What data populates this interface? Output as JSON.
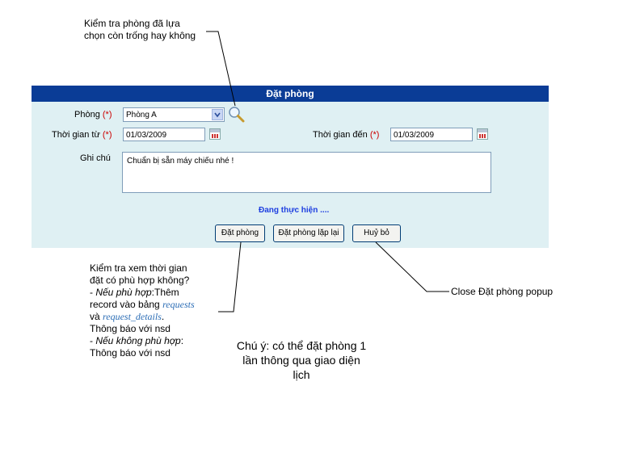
{
  "annotations": {
    "search_note_line1": "Kiểm tra phòng đã lựa",
    "search_note_line2": "chọn còn trống hay không",
    "book_note": {
      "l1": "Kiểm tra xem thời gian",
      "l2": "đặt có phù hợp không?",
      "l3_prefix": "- ",
      "l3_italic": "Nếu phù hợp",
      "l3_rest": ":Thêm",
      "l4_text": "record vào bảng ",
      "l4_table": "requests",
      "l5_text": "và ",
      "l5_table": "request_details",
      "l5_end": ".",
      "l6": "Thông báo với nsd",
      "l7_prefix": "- ",
      "l7_italic": "Nếu không phù hợp",
      "l7_rest": ":",
      "l8": "Thông báo với nsd"
    },
    "cancel_note": "Close Đặt phòng popup",
    "footnote_line1": "Chú ý: có thể đặt phòng 1",
    "footnote_line2": "lần thông qua giao diện",
    "footnote_line3": "lịch"
  },
  "dialog": {
    "title": "Đặt phòng",
    "room_label": "Phòng",
    "required_mark": "(*)",
    "room_value": "Phòng A",
    "from_label": "Thời gian từ",
    "from_value": "01/03/2009",
    "to_label": "Thời gian đến",
    "to_value": "01/03/2009",
    "note_label": "Ghi chú",
    "note_value": "Chuẩn bị sẵn máy chiếu nhé !",
    "status_text": "Đang thực hiện ....",
    "book_button": "Đặt phòng",
    "recurring_button": "Đặt phòng lặp lại",
    "cancel_button": "Huỷ bỏ"
  },
  "icons": {
    "search": "magnifier-icon",
    "dropdown": "chevron-down-icon",
    "calendar": "calendar-icon"
  },
  "colors": {
    "title_bar": "#0a3c96",
    "panel_bg": "#dff0f3",
    "required": "#cc0000",
    "status": "#1d3ee0"
  }
}
